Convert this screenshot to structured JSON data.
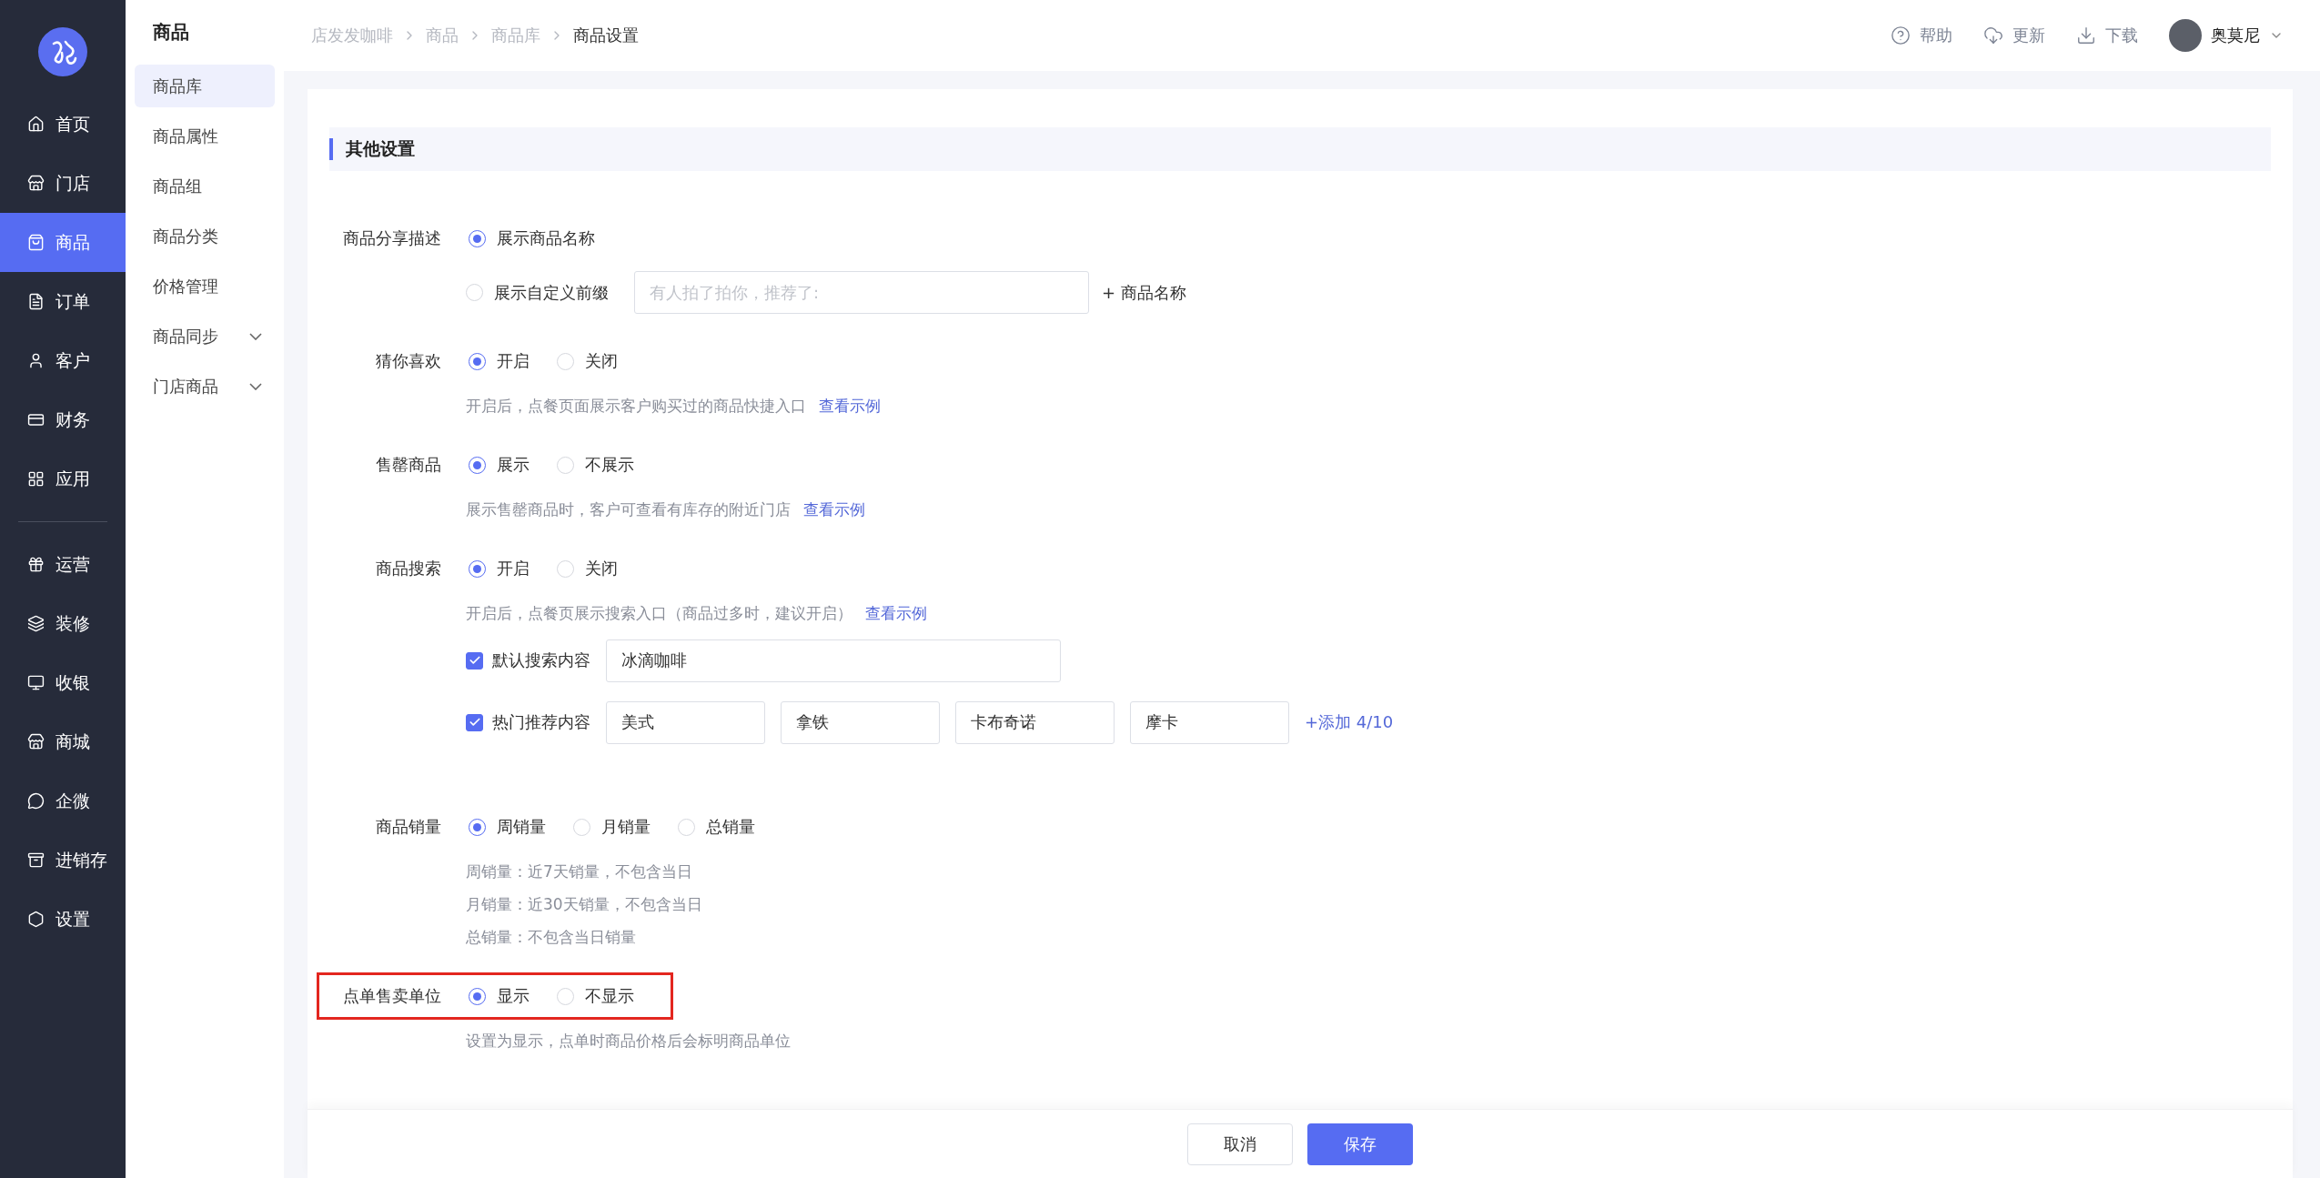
{
  "nav_main": [
    {
      "label": "首页",
      "selected": false
    },
    {
      "label": "门店",
      "selected": false
    },
    {
      "label": "商品",
      "selected": true
    },
    {
      "label": "订单",
      "selected": false
    },
    {
      "label": "客户",
      "selected": false
    },
    {
      "label": "财务",
      "selected": false
    },
    {
      "label": "应用",
      "selected": false
    }
  ],
  "nav_more": [
    {
      "label": "运营",
      "selected": false
    },
    {
      "label": "装修",
      "selected": false
    },
    {
      "label": "收银",
      "selected": false
    },
    {
      "label": "商城",
      "selected": false
    },
    {
      "label": "企微",
      "selected": false
    },
    {
      "label": "进销存",
      "selected": false
    },
    {
      "label": "设置",
      "selected": false
    }
  ],
  "submenu": {
    "title": "商品",
    "items": [
      {
        "label": "商品库",
        "selected": true,
        "expandable": false
      },
      {
        "label": "商品属性",
        "selected": false,
        "expandable": false
      },
      {
        "label": "商品组",
        "selected": false,
        "expandable": false
      },
      {
        "label": "商品分类",
        "selected": false,
        "expandable": false
      },
      {
        "label": "价格管理",
        "selected": false,
        "expandable": false
      },
      {
        "label": "商品同步",
        "selected": false,
        "expandable": true
      },
      {
        "label": "门店商品",
        "selected": false,
        "expandable": true
      }
    ]
  },
  "breadcrumb": [
    "店发发咖啡",
    "商品",
    "商品库",
    "商品设置"
  ],
  "header_actions": [
    "帮助",
    "更新",
    "下载"
  ],
  "user": {
    "name": "奥莫尼"
  },
  "section_title": "其他设置",
  "settings": [
    {
      "label": "商品分享描述",
      "highlighted": false,
      "rows": [
        {
          "kind": "radios",
          "options": [
            {
              "label": "展示商品名称",
              "selected": true
            }
          ]
        },
        {
          "kind": "radio-input",
          "option": {
            "label": "展示自定义前缀",
            "selected": false
          },
          "placeholder": "有人拍了拍你，推荐了:",
          "suffix": "+ 商品名称"
        }
      ]
    },
    {
      "label": "猜你喜欢",
      "highlighted": false,
      "rows": [
        {
          "kind": "radios",
          "options": [
            {
              "label": "开启",
              "selected": true
            },
            {
              "label": "关闭",
              "selected": false
            }
          ]
        },
        {
          "kind": "hint",
          "text": "开启后，点餐页面展示客户购买过的商品快捷入口",
          "link": "查看示例"
        }
      ]
    },
    {
      "label": "售罄商品",
      "highlighted": false,
      "rows": [
        {
          "kind": "radios",
          "options": [
            {
              "label": "展示",
              "selected": true
            },
            {
              "label": "不展示",
              "selected": false
            }
          ]
        },
        {
          "kind": "hint",
          "text": "展示售罄商品时，客户可查看有库存的附近门店",
          "link": "查看示例"
        }
      ]
    },
    {
      "label": "商品搜索",
      "highlighted": false,
      "rows": [
        {
          "kind": "radios",
          "options": [
            {
              "label": "开启",
              "selected": true
            },
            {
              "label": "关闭",
              "selected": false
            }
          ]
        },
        {
          "kind": "hint",
          "text": "开启后，点餐页展示搜索入口（商品过多时，建议开启）",
          "link": "查看示例"
        },
        {
          "kind": "check-input",
          "label": "默认搜索内容",
          "checked": true,
          "values": [
            "冰滴咖啡"
          ]
        },
        {
          "kind": "check-input",
          "label": "热门推荐内容",
          "checked": true,
          "values": [
            "美式",
            "拿铁",
            "卡布奇诺",
            "摩卡"
          ],
          "add_link": "+添加 4/10"
        }
      ]
    },
    {
      "label": "商品销量",
      "highlighted": false,
      "rows": [
        {
          "kind": "radios",
          "options": [
            {
              "label": "周销量",
              "selected": true
            },
            {
              "label": "月销量",
              "selected": false
            },
            {
              "label": "总销量",
              "selected": false
            }
          ]
        },
        {
          "kind": "hint",
          "text": "周销量：近7天销量，不包含当日"
        },
        {
          "kind": "hint",
          "text": "月销量：近30天销量，不包含当日"
        },
        {
          "kind": "hint",
          "text": "总销量：不包含当日销量"
        }
      ]
    },
    {
      "label": "点单售卖单位",
      "highlighted": true,
      "rows": [
        {
          "kind": "radios",
          "options": [
            {
              "label": "显示",
              "selected": true
            },
            {
              "label": "不显示",
              "selected": false
            }
          ]
        },
        {
          "kind": "hint",
          "text": "设置为显示，点单时商品价格后会标明商品单位"
        }
      ]
    }
  ],
  "footer_buttons": [
    {
      "label": "取消",
      "kind": "secondary"
    },
    {
      "label": "保存",
      "kind": "primary"
    }
  ]
}
